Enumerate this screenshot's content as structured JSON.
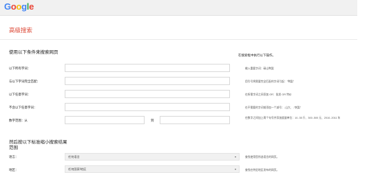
{
  "header": {
    "logo_letters": [
      {
        "char": "G",
        "color": "#4285f4"
      },
      {
        "char": "o",
        "color": "#ea4335"
      },
      {
        "char": "o",
        "color": "#fbbc05"
      },
      {
        "char": "g",
        "color": "#4285f4"
      },
      {
        "char": "l",
        "color": "#34a853"
      },
      {
        "char": "e",
        "color": "#ea4335"
      }
    ]
  },
  "page": {
    "title": "高级搜索"
  },
  "section1": {
    "heading": "使用以下条件来搜索网页",
    "hint": "在搜索框中执行以下操作。",
    "rows": [
      {
        "label": "以下所有字词：",
        "hint": "输入重要字词：砀山鸭梨"
      },
      {
        "label": "与以下字词完全匹配：",
        "hint": "用引号将需要完全匹配的字词引起：\"鸭梨\""
      },
      {
        "label": "以下任意字词：",
        "hint": "在所需字词之间添加 OR：批发 OR 特价"
      },
      {
        "label": "不含以下任意字词：",
        "hint": "在不需要的字词前添加一个减号：-山大、-\"刺梨\""
      },
      {
        "label": "数字范围：从",
        "to": "到",
        "hint": "在数字之间加上两个句号并添加度量单位：10..35 斤、300..500 元、2010..2011 年"
      }
    ]
  },
  "section2": {
    "heading": "然后按以下标准缩小搜索结果范围",
    "rows": [
      {
        "label": "语言：",
        "value": "任何语言",
        "hint": "查找使用您所选语言的网页。"
      },
      {
        "label": "地区：",
        "value": "任何国家/地区",
        "hint": "查找在特定地区发布的网页。"
      }
    ],
    "arrow_icon": "▾"
  }
}
